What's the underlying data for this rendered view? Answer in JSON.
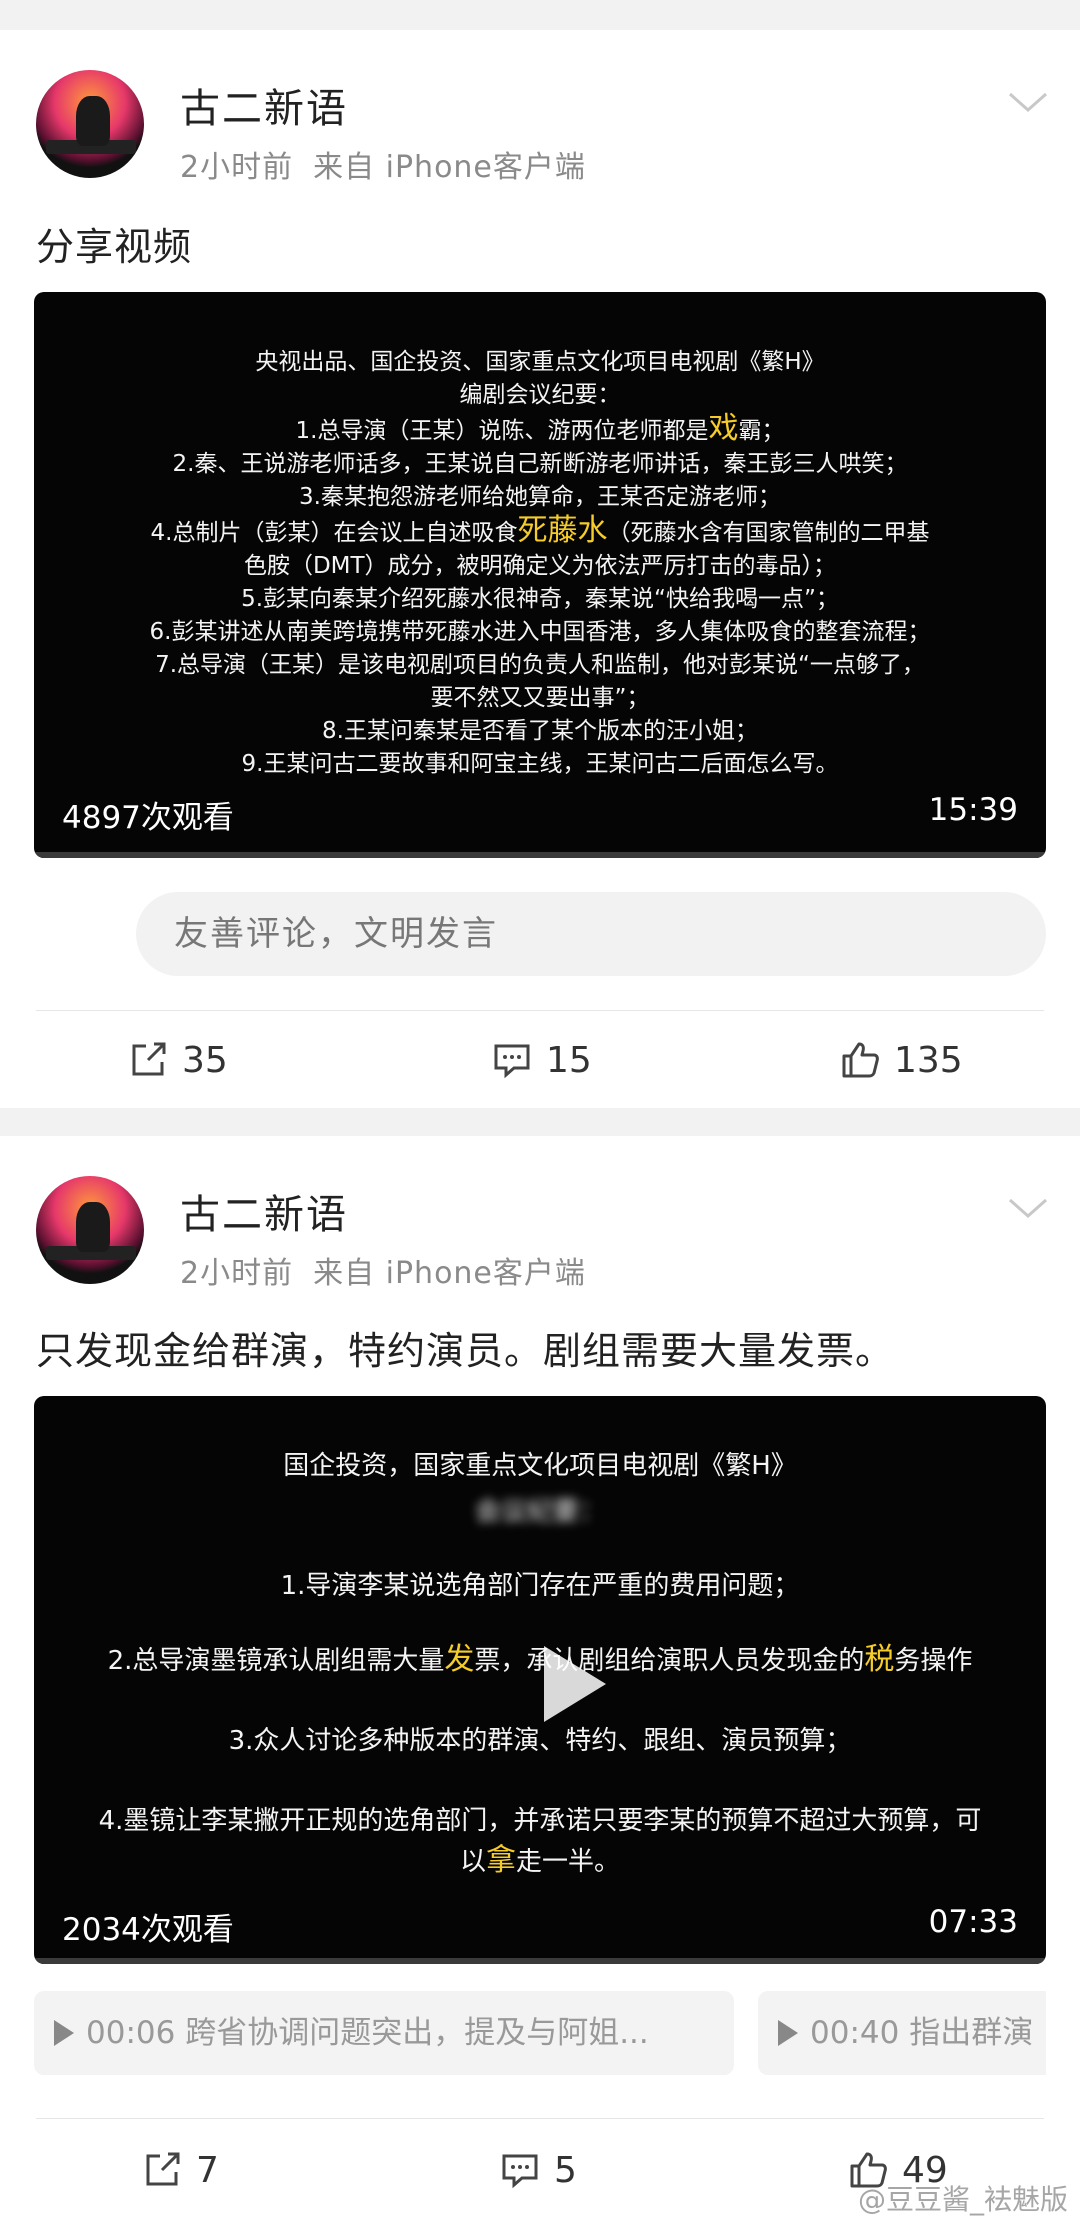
{
  "posts": [
    {
      "username": "古二新语",
      "time": "2小时前",
      "source": "来自 iPhone客户端",
      "text": "分享视频",
      "video": {
        "lines": [
          "央视出品、国企投资、国家重点文化项目电视剧《繁H》",
          "编剧会议纪要：",
          "1.总导演（王某）说陈、游两位老师都是",
          "2.秦、王说游老师话多，王某说自己新断游老师讲话，秦王彭三人哄笑；",
          "3.秦某抱怨游老师给她算命，王某否定游老师；",
          "4.总制片（彭某）在会议上自述吸食",
          "色胺（DMT）成分，被明确定义为依法严厉打击的毒品）；",
          "5.彭某向秦某介绍死藤水很神奇，秦某说“快给我喝一点”；",
          "6.彭某讲述从南美跨境携带死藤水进入中国香港，多人集体吸食的整套流程；",
          "7.总导演（王某）是该电视剧项目的负责人和监制，他对彭某说“一点够了，",
          "要不然又又要出事”；",
          "8.王某问秦某是否看了某个版本的汪小姐；",
          "9.王某问古二要故事和阿宝主线，王某问古二后面怎么写。"
        ],
        "line3_hl": "戏",
        "line3_tail": "霸；",
        "line6_hl": "死藤水",
        "line6_tail": "（死藤水含有国家管制的二甲基",
        "views": "4897次观看",
        "duration": "15:39"
      },
      "comment_placeholder": "友善评论，文明发言",
      "actions": {
        "share": "35",
        "comment": "15",
        "like": "135"
      }
    },
    {
      "username": "古二新语",
      "time": "2小时前",
      "source": "来自 iPhone客户端",
      "text": "只发现金给群演，特约演员。剧组需要大量发票。",
      "video": {
        "line1": "国企投资，国家重点文化项目电视剧《繁H》",
        "line2": "会议纪要：",
        "line3": "1.导演李某说选角部门存在严重的费用问题；",
        "line4_a": "2.总导演墨镜承认剧组需大量",
        "line4_hl1": "发",
        "line4_b": "票，承认剧组给演职人员发现金的",
        "line4_hl2": "税",
        "line4_c": "务操作",
        "line5": "3.众人讨论多种版本的群演、特约、跟组、演员预算；",
        "line6": "4.墨镜让李某撇开正规的选角部门，并承诺只要李某的预算不超过大预算，可",
        "line7_a": "以",
        "line7_hl": "拿",
        "line7_b": "走一半。",
        "views": "2034次观看",
        "duration": "07:33"
      },
      "chapters": [
        {
          "time": "00:06",
          "title": "跨省协调问题突出，提及与阿姐..."
        },
        {
          "time": "00:40",
          "title": "指出群演"
        }
      ],
      "actions": {
        "share": "7",
        "comment": "5",
        "like": "49"
      }
    }
  ],
  "watermark": "@豆豆酱_袪魅版"
}
